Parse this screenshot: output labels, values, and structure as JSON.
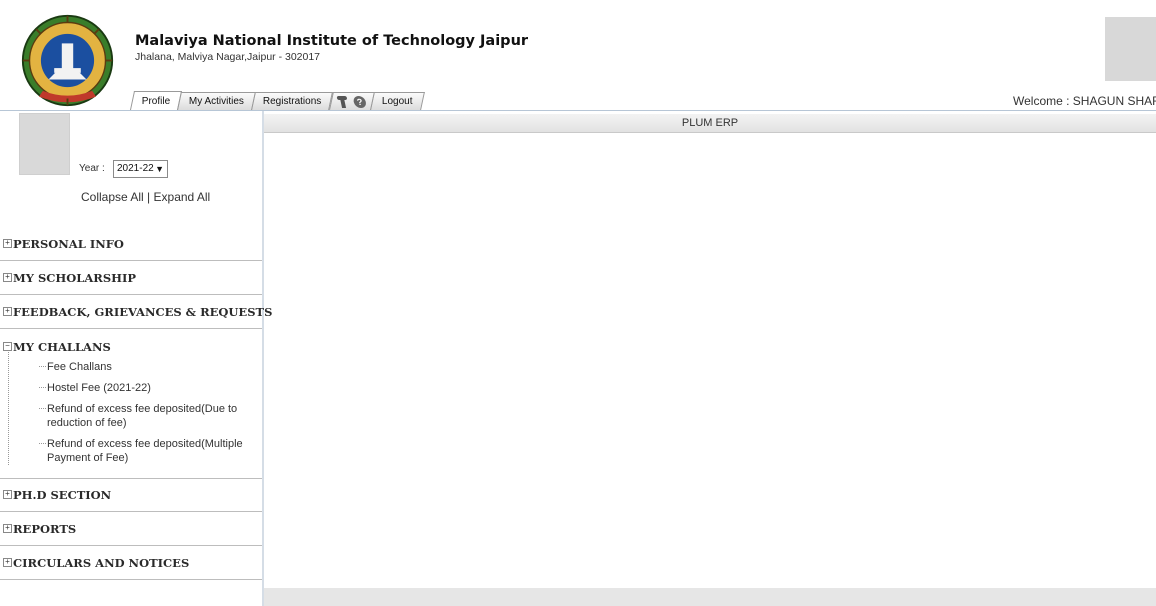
{
  "header": {
    "institute_name": "Malaviya National Institute of Technology Jaipur",
    "institute_address": "Jhalana, Malviya Nagar,Jaipur - 302017",
    "welcome_text": "Welcome : SHAGUN SHARMA"
  },
  "tabs": [
    {
      "label": "Profile"
    },
    {
      "label": "My Activities"
    },
    {
      "label": "Registrations"
    },
    {
      "label": "Logout"
    }
  ],
  "tab_icons": [
    "wrench-icon",
    "help-icon"
  ],
  "sidebar": {
    "year_label": "Year :",
    "year_value": "2021-22",
    "collapse_all": "Collapse All",
    "separator": "|",
    "expand_all": "Expand All",
    "sections": [
      {
        "title": "PERSONAL INFO",
        "expanded": false
      },
      {
        "title": "MY SCHOLARSHIP",
        "expanded": false
      },
      {
        "title": "FEEDBACK, GRIEVANCES & REQUESTS",
        "expanded": false
      },
      {
        "title": "MY CHALLANS",
        "expanded": true
      },
      {
        "title": "PH.D SECTION",
        "expanded": false
      },
      {
        "title": "REPORTS",
        "expanded": false
      },
      {
        "title": "CIRCULARS AND NOTICES",
        "expanded": false
      }
    ],
    "challans_items": [
      "Fee Challans",
      "Hostel Fee (2021-22)",
      "Refund of excess fee deposited(Due to reduction of fee)",
      "Refund of excess fee deposited(Multiple Payment of Fee)"
    ]
  },
  "main": {
    "header_title": "PLUM ERP"
  },
  "colors": {
    "border": "#bdbdbd",
    "header_bar": "#e2e2e2",
    "photo_placeholder": "#d9d9d9"
  }
}
